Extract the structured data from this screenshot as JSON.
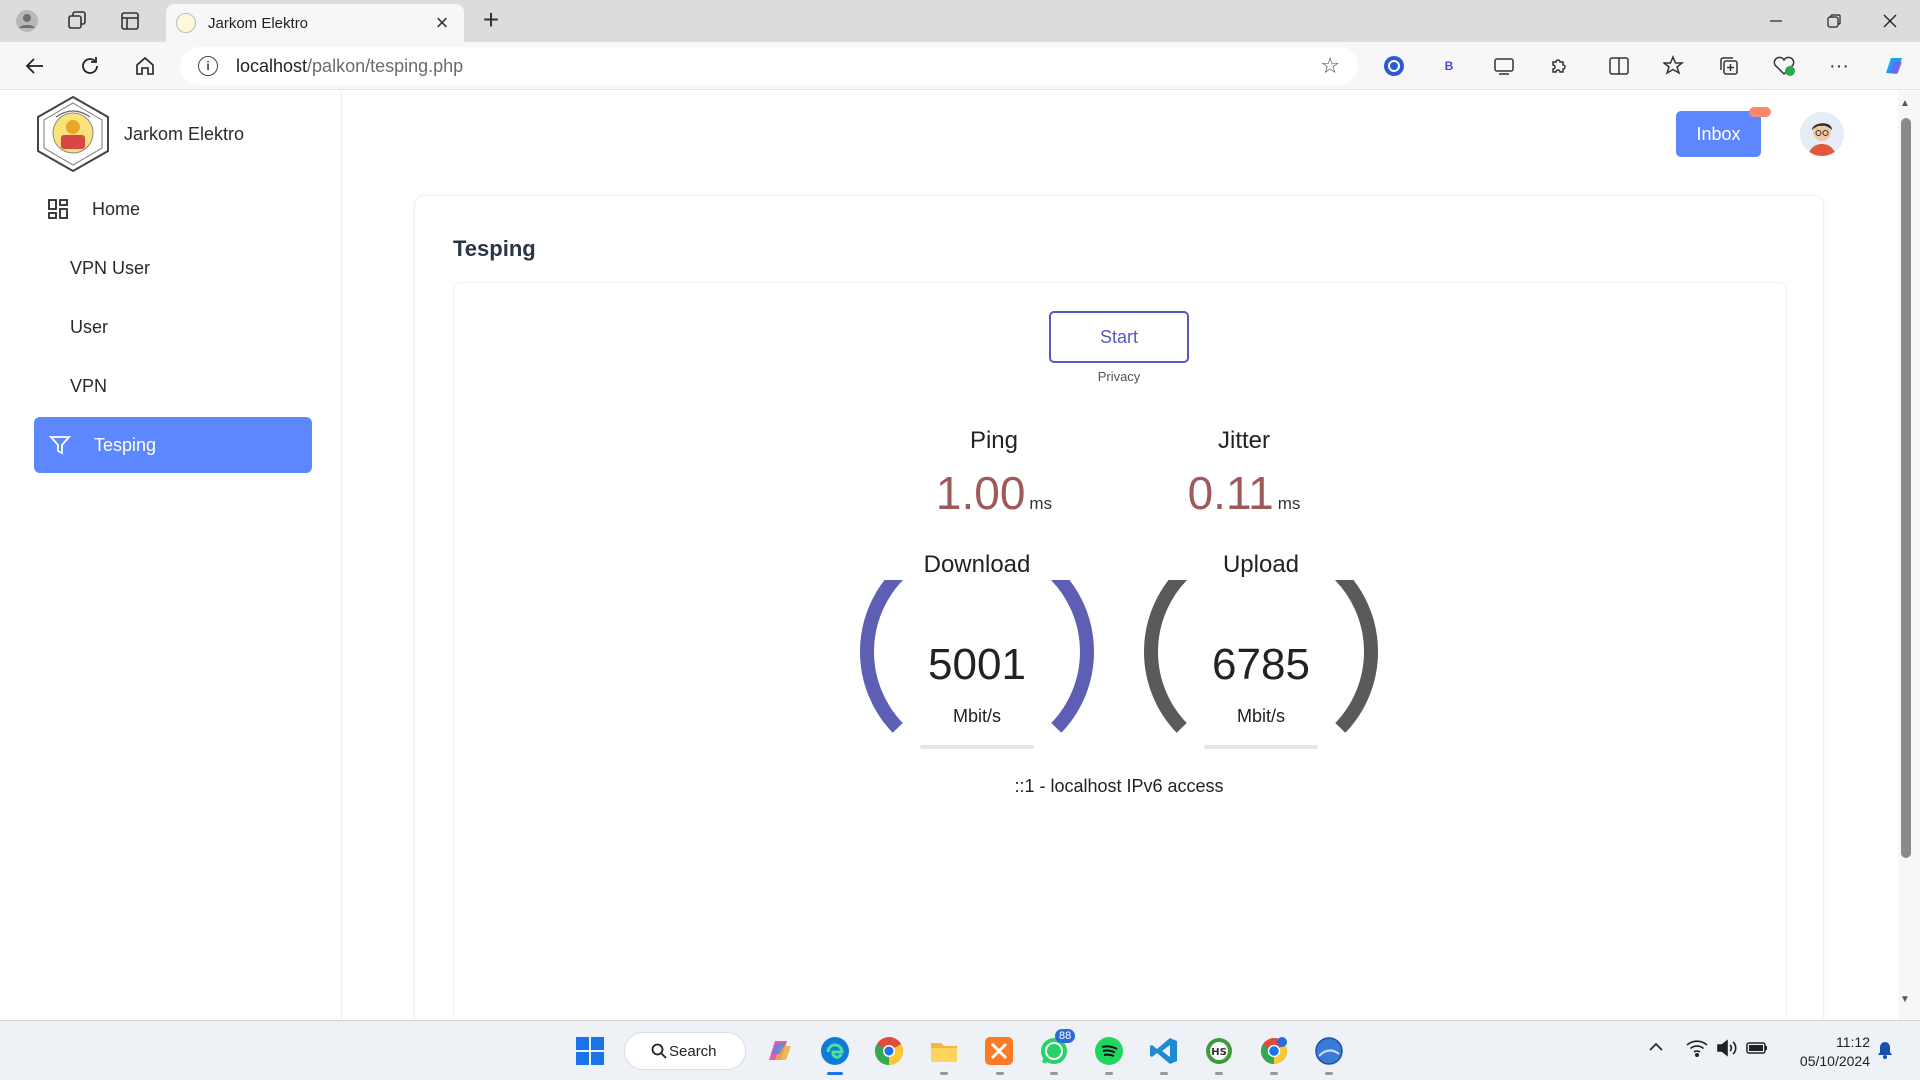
{
  "browser": {
    "tab_title": "Jarkom Elektro",
    "url_host": "localhost",
    "url_path": "/palkon/tesping.php",
    "extension_b_label": "B"
  },
  "app": {
    "brand_name": "Jarkom Elektro",
    "inbox_label": "Inbox",
    "accent_color": "#5d87ff"
  },
  "sidebar": {
    "items": [
      {
        "label": "Home",
        "icon": "dashboard-icon",
        "active": false
      },
      {
        "label": "VPN User",
        "icon": "",
        "active": false
      },
      {
        "label": "User",
        "icon": "",
        "active": false
      },
      {
        "label": "VPN",
        "icon": "",
        "active": false
      },
      {
        "label": "Tesping",
        "icon": "filter-icon",
        "active": true
      }
    ]
  },
  "page": {
    "title": "Tesping",
    "start_label": "Start",
    "privacy_label": "Privacy",
    "ping": {
      "label": "Ping",
      "value": "1.00",
      "unit": "ms"
    },
    "jitter": {
      "label": "Jitter",
      "value": "0.11",
      "unit": "ms"
    },
    "download": {
      "label": "Download",
      "value": "5001",
      "unit": "Mbit/s",
      "color": "#5d5fb5"
    },
    "upload": {
      "label": "Upload",
      "value": "6785",
      "unit": "Mbit/s",
      "color": "#5a5a5a"
    },
    "ip_info": "::1 - localhost IPv6 access"
  },
  "taskbar": {
    "search_label": "Search",
    "whatsapp_badge": "88",
    "time": "11:12",
    "date": "05/10/2024"
  }
}
